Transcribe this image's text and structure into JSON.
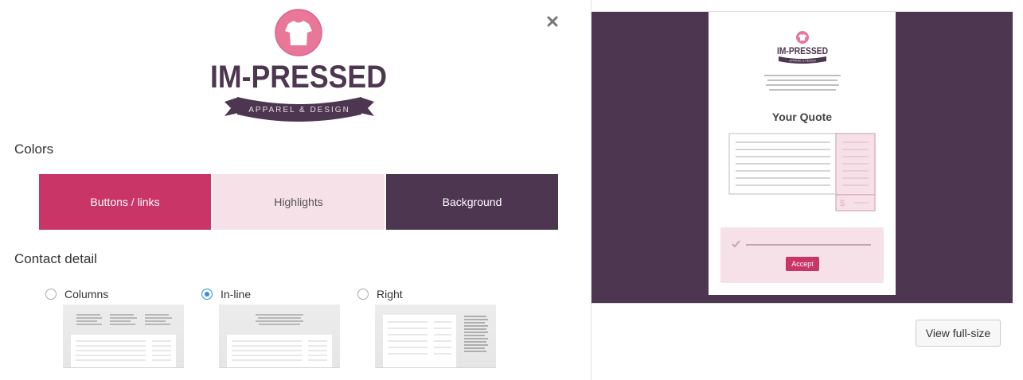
{
  "colors_heading": "Colors",
  "contact_heading": "Contact detail",
  "swatches": [
    {
      "label": "Buttons / links",
      "color": "#c83566"
    },
    {
      "label": "Highlights",
      "color": "#f7e1e8"
    },
    {
      "label": "Background",
      "color": "#4d3650"
    }
  ],
  "logo": {
    "brand": "IM-PRESSED",
    "tagline": "APPAREL & DESIGN",
    "text_color": "#4d3650",
    "badge_color": "#e8779a"
  },
  "contact_options": [
    {
      "label": "Columns",
      "selected": false
    },
    {
      "label": "In-line",
      "selected": true
    },
    {
      "label": "Right",
      "selected": false
    }
  ],
  "preview": {
    "doc_title": "Your Quote",
    "accept_label": "Accept",
    "currency_symbol": "$",
    "background_color": "#4d3650",
    "highlight_color": "#f7e1e8",
    "button_color": "#c83566"
  },
  "view_full_size_label": "View full-size",
  "icons": {
    "close": "close-icon",
    "check": "check-icon",
    "tshirt": "tshirt-icon"
  }
}
